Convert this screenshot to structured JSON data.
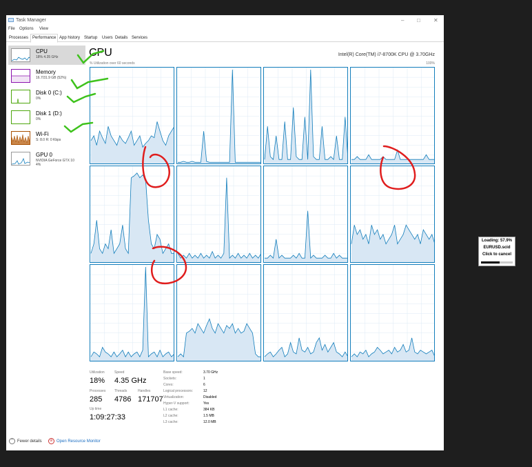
{
  "window": {
    "title": "Task Manager",
    "controls": [
      "–",
      "□",
      "✕"
    ]
  },
  "menu": [
    "File",
    "Options",
    "View"
  ],
  "tabs": [
    "Processes",
    "Performance",
    "App history",
    "Startup",
    "Users",
    "Details",
    "Services"
  ],
  "active_tab": "Performance",
  "sidebar": [
    {
      "name": "CPU",
      "sub": "18% 4.35 GHz",
      "color": "#117dbb",
      "selected": true
    },
    {
      "name": "Memory",
      "sub": "16.7/31.9 GB (52%)",
      "color": "#8b12ae"
    },
    {
      "name": "Disk 0 (C:)",
      "sub": "0%",
      "color": "#4da60c"
    },
    {
      "name": "Disk 1 (D:)",
      "sub": "0%",
      "color": "#4da60c"
    },
    {
      "name": "Wi-Fi",
      "sub": "S: 8.0  R: 0 Kbps",
      "color": "#a74f01"
    },
    {
      "name": "GPU 0",
      "sub": "NVIDIA GeForce GTX 10",
      "sub2": "4%",
      "color": "#117dbb"
    }
  ],
  "main": {
    "title": "CPU",
    "model": "Intel(R) Core(TM) i7-8700K CPU @ 3.70GHz",
    "util_label": "% Utilization over 60 seconds",
    "util_max": "100%"
  },
  "stats": {
    "utilization_label": "Utilization",
    "utilization": "18%",
    "speed_label": "Speed",
    "speed": "4.35 GHz",
    "processes_label": "Processes",
    "processes": "285",
    "threads_label": "Threads",
    "threads": "4786",
    "handles_label": "Handles",
    "handles": "171707",
    "uptime_label": "Up time",
    "uptime": "1:09:27:33"
  },
  "specs": [
    {
      "k": "Base speed:",
      "v": "3.70 GHz"
    },
    {
      "k": "Sockets:",
      "v": "1"
    },
    {
      "k": "Cores:",
      "v": "6"
    },
    {
      "k": "Logical processors:",
      "v": "12"
    },
    {
      "k": "Virtualization:",
      "v": "Disabled"
    },
    {
      "k": "Hyper-V support:",
      "v": "Yes"
    },
    {
      "k": "L1 cache:",
      "v": "384 KB"
    },
    {
      "k": "L2 cache:",
      "v": "1.5 MB"
    },
    {
      "k": "L3 cache:",
      "v": "12.0 MB"
    }
  ],
  "footer": {
    "fewer": "Fewer details",
    "resmon": "Open Resource Monitor"
  },
  "overlay": {
    "line1": "Loading: 57.9%",
    "line2": "EURUSD.scid",
    "line3": "Click to cancel",
    "progress": 0.579
  },
  "chart_data": {
    "type": "area",
    "title": "CPU",
    "ylabel": "% Utilization over 60 seconds",
    "ylim": [
      0,
      100
    ],
    "series": [
      {
        "values": [
          25,
          30,
          20,
          35,
          28,
          22,
          40,
          30,
          25,
          20,
          30,
          25,
          22,
          28,
          35,
          20,
          25,
          30,
          18,
          22,
          25,
          30,
          28,
          45,
          35,
          25,
          20,
          30,
          35,
          40
        ]
      },
      {
        "values": [
          2,
          2,
          3,
          2,
          2,
          3,
          2,
          2,
          2,
          35,
          3,
          2,
          2,
          2,
          2,
          2,
          2,
          2,
          2,
          100,
          2,
          2,
          2,
          2,
          2,
          2,
          2,
          2,
          2,
          2
        ]
      },
      {
        "values": [
          5,
          40,
          8,
          5,
          30,
          5,
          5,
          45,
          5,
          5,
          60,
          8,
          5,
          5,
          50,
          5,
          100,
          8,
          5,
          5,
          40,
          5,
          5,
          8,
          5,
          30,
          5,
          5,
          50,
          5
        ]
      },
      {
        "values": [
          5,
          5,
          8,
          5,
          5,
          5,
          10,
          5,
          5,
          5,
          5,
          8,
          5,
          5,
          5,
          5,
          15,
          5,
          5,
          5,
          5,
          5,
          5,
          5,
          5,
          5,
          10,
          5,
          5,
          5
        ]
      },
      {
        "values": [
          10,
          20,
          45,
          15,
          10,
          20,
          15,
          35,
          10,
          15,
          20,
          40,
          15,
          10,
          90,
          92,
          95,
          90,
          93,
          88,
          45,
          20,
          15,
          30,
          25,
          10,
          15,
          20,
          10,
          10
        ]
      },
      {
        "values": [
          10,
          5,
          8,
          5,
          10,
          5,
          8,
          5,
          10,
          5,
          8,
          5,
          12,
          5,
          8,
          5,
          10,
          90,
          5,
          8,
          5,
          10,
          5,
          8,
          5,
          10,
          5,
          8,
          5,
          10
        ]
      },
      {
        "values": [
          5,
          5,
          8,
          5,
          25,
          5,
          8,
          5,
          5,
          5,
          8,
          5,
          10,
          5,
          5,
          55,
          5,
          8,
          5,
          5,
          5,
          8,
          5,
          5,
          10,
          5,
          8,
          5,
          5,
          5
        ]
      },
      {
        "values": [
          20,
          40,
          30,
          35,
          25,
          30,
          20,
          40,
          30,
          35,
          25,
          30,
          20,
          25,
          30,
          40,
          20,
          25,
          30,
          40,
          35,
          30,
          25,
          30,
          20,
          35,
          30,
          25,
          30,
          20
        ]
      },
      {
        "values": [
          5,
          10,
          8,
          5,
          15,
          10,
          8,
          5,
          10,
          5,
          8,
          12,
          5,
          10,
          5,
          8,
          10,
          5,
          12,
          100,
          5,
          8,
          10,
          5,
          12,
          5,
          8,
          10,
          5,
          8
        ]
      },
      {
        "values": [
          5,
          8,
          5,
          30,
          32,
          35,
          30,
          40,
          35,
          30,
          38,
          45,
          35,
          30,
          40,
          35,
          30,
          38,
          35,
          40,
          30,
          35,
          30,
          32,
          40,
          35,
          30,
          8,
          5,
          5
        ]
      },
      {
        "values": [
          5,
          8,
          10,
          5,
          8,
          12,
          15,
          5,
          8,
          20,
          10,
          8,
          25,
          12,
          10,
          15,
          8,
          10,
          20,
          25,
          12,
          18,
          10,
          15,
          20,
          10,
          8,
          5,
          10,
          5
        ]
      },
      {
        "values": [
          5,
          8,
          5,
          10,
          8,
          12,
          5,
          8,
          10,
          15,
          12,
          8,
          10,
          12,
          8,
          15,
          10,
          12,
          18,
          10,
          12,
          25,
          10,
          8,
          12,
          10,
          8,
          10,
          12,
          5
        ]
      }
    ]
  }
}
